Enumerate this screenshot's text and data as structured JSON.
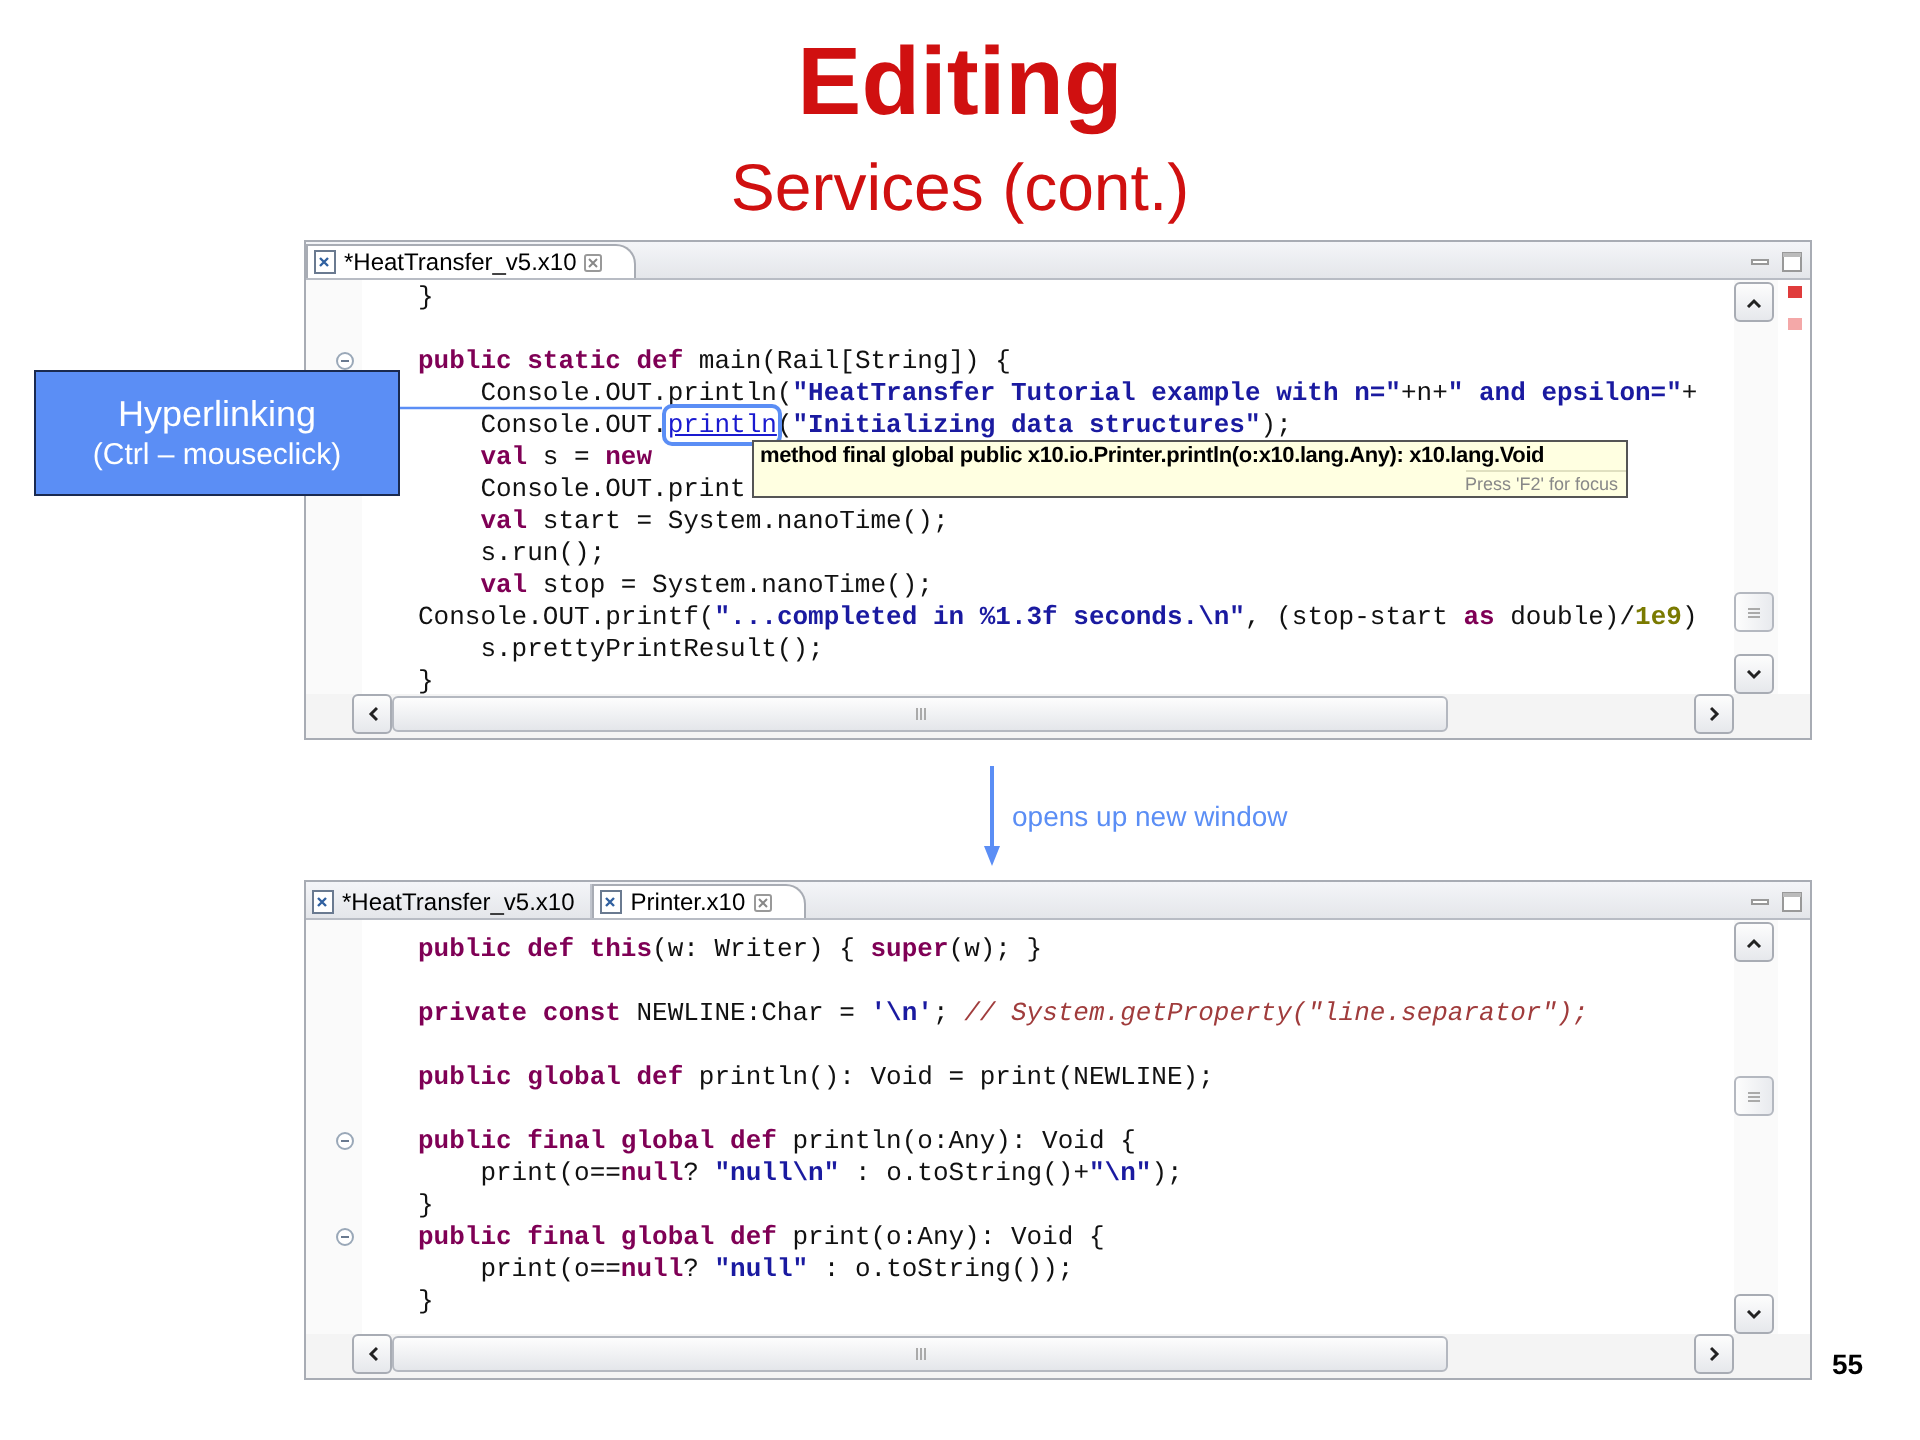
{
  "slide": {
    "title": "Editing",
    "subtitle": "Services (cont.)",
    "page_number": "55"
  },
  "editors": [
    {
      "tabs": [
        {
          "label": "*HeatTransfer_v5.x10",
          "selected": true
        }
      ],
      "markers": [
        {
          "color": "#e03c3c"
        },
        {
          "color": "#f4a8a8"
        }
      ],
      "lines": [
        {
          "kind": "code",
          "fold": false,
          "tokens": [
            {
              "kind": "plain",
              "t": "}"
            }
          ]
        },
        {
          "kind": "blank"
        },
        {
          "kind": "code",
          "fold": true,
          "tokens": [
            {
              "kind": "kw",
              "t": "public static def"
            },
            {
              "kind": "plain",
              "t": " main(Rail[String]) {"
            }
          ]
        },
        {
          "kind": "code",
          "fold": false,
          "tokens": [
            {
              "kind": "plain",
              "t": "    Console.OUT.println("
            },
            {
              "kind": "str",
              "t": "\"HeatTransfer Tutorial example with n=\""
            },
            {
              "kind": "plain",
              "t": "+n+"
            },
            {
              "kind": "str",
              "t": "\" and epsilon=\""
            },
            {
              "kind": "plain",
              "t": "+"
            }
          ]
        },
        {
          "kind": "code",
          "fold": false,
          "tokens": [
            {
              "kind": "plain",
              "t": "    Console.OUT."
            },
            {
              "kind": "link",
              "t": "println"
            },
            {
              "kind": "plain",
              "t": "("
            },
            {
              "kind": "str",
              "t": "\"Initializing data structures\""
            },
            {
              "kind": "plain",
              "t": ");"
            }
          ]
        },
        {
          "kind": "code",
          "fold": false,
          "tokens": [
            {
              "kind": "kw",
              "t": "    val"
            },
            {
              "kind": "plain",
              "t": " s = "
            },
            {
              "kind": "kw",
              "t": "new"
            }
          ]
        },
        {
          "kind": "code",
          "fold": false,
          "tokens": [
            {
              "kind": "plain",
              "t": "    Console.OUT.print"
            }
          ]
        },
        {
          "kind": "code",
          "fold": false,
          "tokens": [
            {
              "kind": "kw",
              "t": "    val"
            },
            {
              "kind": "plain",
              "t": " start = System.nanoTime();"
            }
          ]
        },
        {
          "kind": "code",
          "fold": false,
          "tokens": [
            {
              "kind": "plain",
              "t": "    s.run();"
            }
          ]
        },
        {
          "kind": "code",
          "fold": false,
          "tokens": [
            {
              "kind": "kw",
              "t": "    val"
            },
            {
              "kind": "plain",
              "t": " stop = System.nanoTime();"
            }
          ]
        },
        {
          "kind": "code",
          "fold": false,
          "tokens": [
            {
              "kind": "plain",
              "t": "Console.OUT.printf("
            },
            {
              "kind": "str",
              "t": "\"...completed in %1.3f seconds.\\n\""
            },
            {
              "kind": "plain",
              "t": ", (stop-start "
            },
            {
              "kind": "kw",
              "t": "as"
            },
            {
              "kind": "plain",
              "t": " double)/"
            },
            {
              "kind": "num",
              "t": "1e9"
            },
            {
              "kind": "plain",
              "t": ")"
            }
          ]
        },
        {
          "kind": "code",
          "fold": false,
          "tokens": [
            {
              "kind": "plain",
              "t": "    s.prettyPrintResult();"
            }
          ]
        },
        {
          "kind": "code",
          "fold": false,
          "tokens": [
            {
              "kind": "plain",
              "t": "}"
            }
          ]
        }
      ]
    },
    {
      "tabs": [
        {
          "label": "*HeatTransfer_v5.x10",
          "selected": false
        },
        {
          "label": "Printer.x10",
          "selected": true
        }
      ],
      "lines": [
        {
          "kind": "code",
          "fold": false,
          "tokens": [
            {
              "kind": "kw",
              "t": "public def this"
            },
            {
              "kind": "plain",
              "t": "(w: Writer) { "
            },
            {
              "kind": "kw",
              "t": "super"
            },
            {
              "kind": "plain",
              "t": "(w); }"
            }
          ]
        },
        {
          "kind": "blank"
        },
        {
          "kind": "code",
          "fold": false,
          "tokens": [
            {
              "kind": "kw",
              "t": "private const"
            },
            {
              "kind": "plain",
              "t": " NEWLINE:Char = "
            },
            {
              "kind": "str",
              "t": "'\\n'"
            },
            {
              "kind": "plain",
              "t": "; "
            },
            {
              "kind": "comment",
              "t": "// System.getProperty(\"line.separator\");"
            }
          ]
        },
        {
          "kind": "blank"
        },
        {
          "kind": "code",
          "fold": false,
          "tokens": [
            {
              "kind": "kw",
              "t": "public global def"
            },
            {
              "kind": "plain",
              "t": " println(): Void = print(NEWLINE);"
            }
          ]
        },
        {
          "kind": "blank"
        },
        {
          "kind": "code",
          "fold": true,
          "tokens": [
            {
              "kind": "kw",
              "t": "public final global def"
            },
            {
              "kind": "plain",
              "t": " println(o:Any): Void {"
            }
          ]
        },
        {
          "kind": "code",
          "fold": false,
          "tokens": [
            {
              "kind": "plain",
              "t": "    print(o=="
            },
            {
              "kind": "kw",
              "t": "null"
            },
            {
              "kind": "plain",
              "t": "? "
            },
            {
              "kind": "str",
              "t": "\"null\\n\""
            },
            {
              "kind": "plain",
              "t": " : o.toString()+"
            },
            {
              "kind": "str",
              "t": "\"\\n\""
            },
            {
              "kind": "plain",
              "t": ");"
            }
          ]
        },
        {
          "kind": "code",
          "fold": false,
          "tokens": [
            {
              "kind": "plain",
              "t": "}"
            }
          ]
        },
        {
          "kind": "code",
          "fold": true,
          "tokens": [
            {
              "kind": "kw",
              "t": "public final global def"
            },
            {
              "kind": "plain",
              "t": " print(o:Any): Void {"
            }
          ]
        },
        {
          "kind": "code",
          "fold": false,
          "tokens": [
            {
              "kind": "plain",
              "t": "    print(o=="
            },
            {
              "kind": "kw",
              "t": "null"
            },
            {
              "kind": "plain",
              "t": "? "
            },
            {
              "kind": "str",
              "t": "\"null\""
            },
            {
              "kind": "plain",
              "t": " : o.toString());"
            }
          ]
        },
        {
          "kind": "code",
          "fold": false,
          "tokens": [
            {
              "kind": "plain",
              "t": "}"
            }
          ]
        }
      ]
    }
  ],
  "transition": {
    "label": "opens up new window"
  },
  "callout": {
    "title": "Hyperlinking",
    "text": "(Ctrl – mouseclick)"
  },
  "tooltip": {
    "signature": "method final global public x10.io.Printer.println(o:x10.lang.Any): x10.lang.Void",
    "hint": "Press 'F2' for focus"
  }
}
